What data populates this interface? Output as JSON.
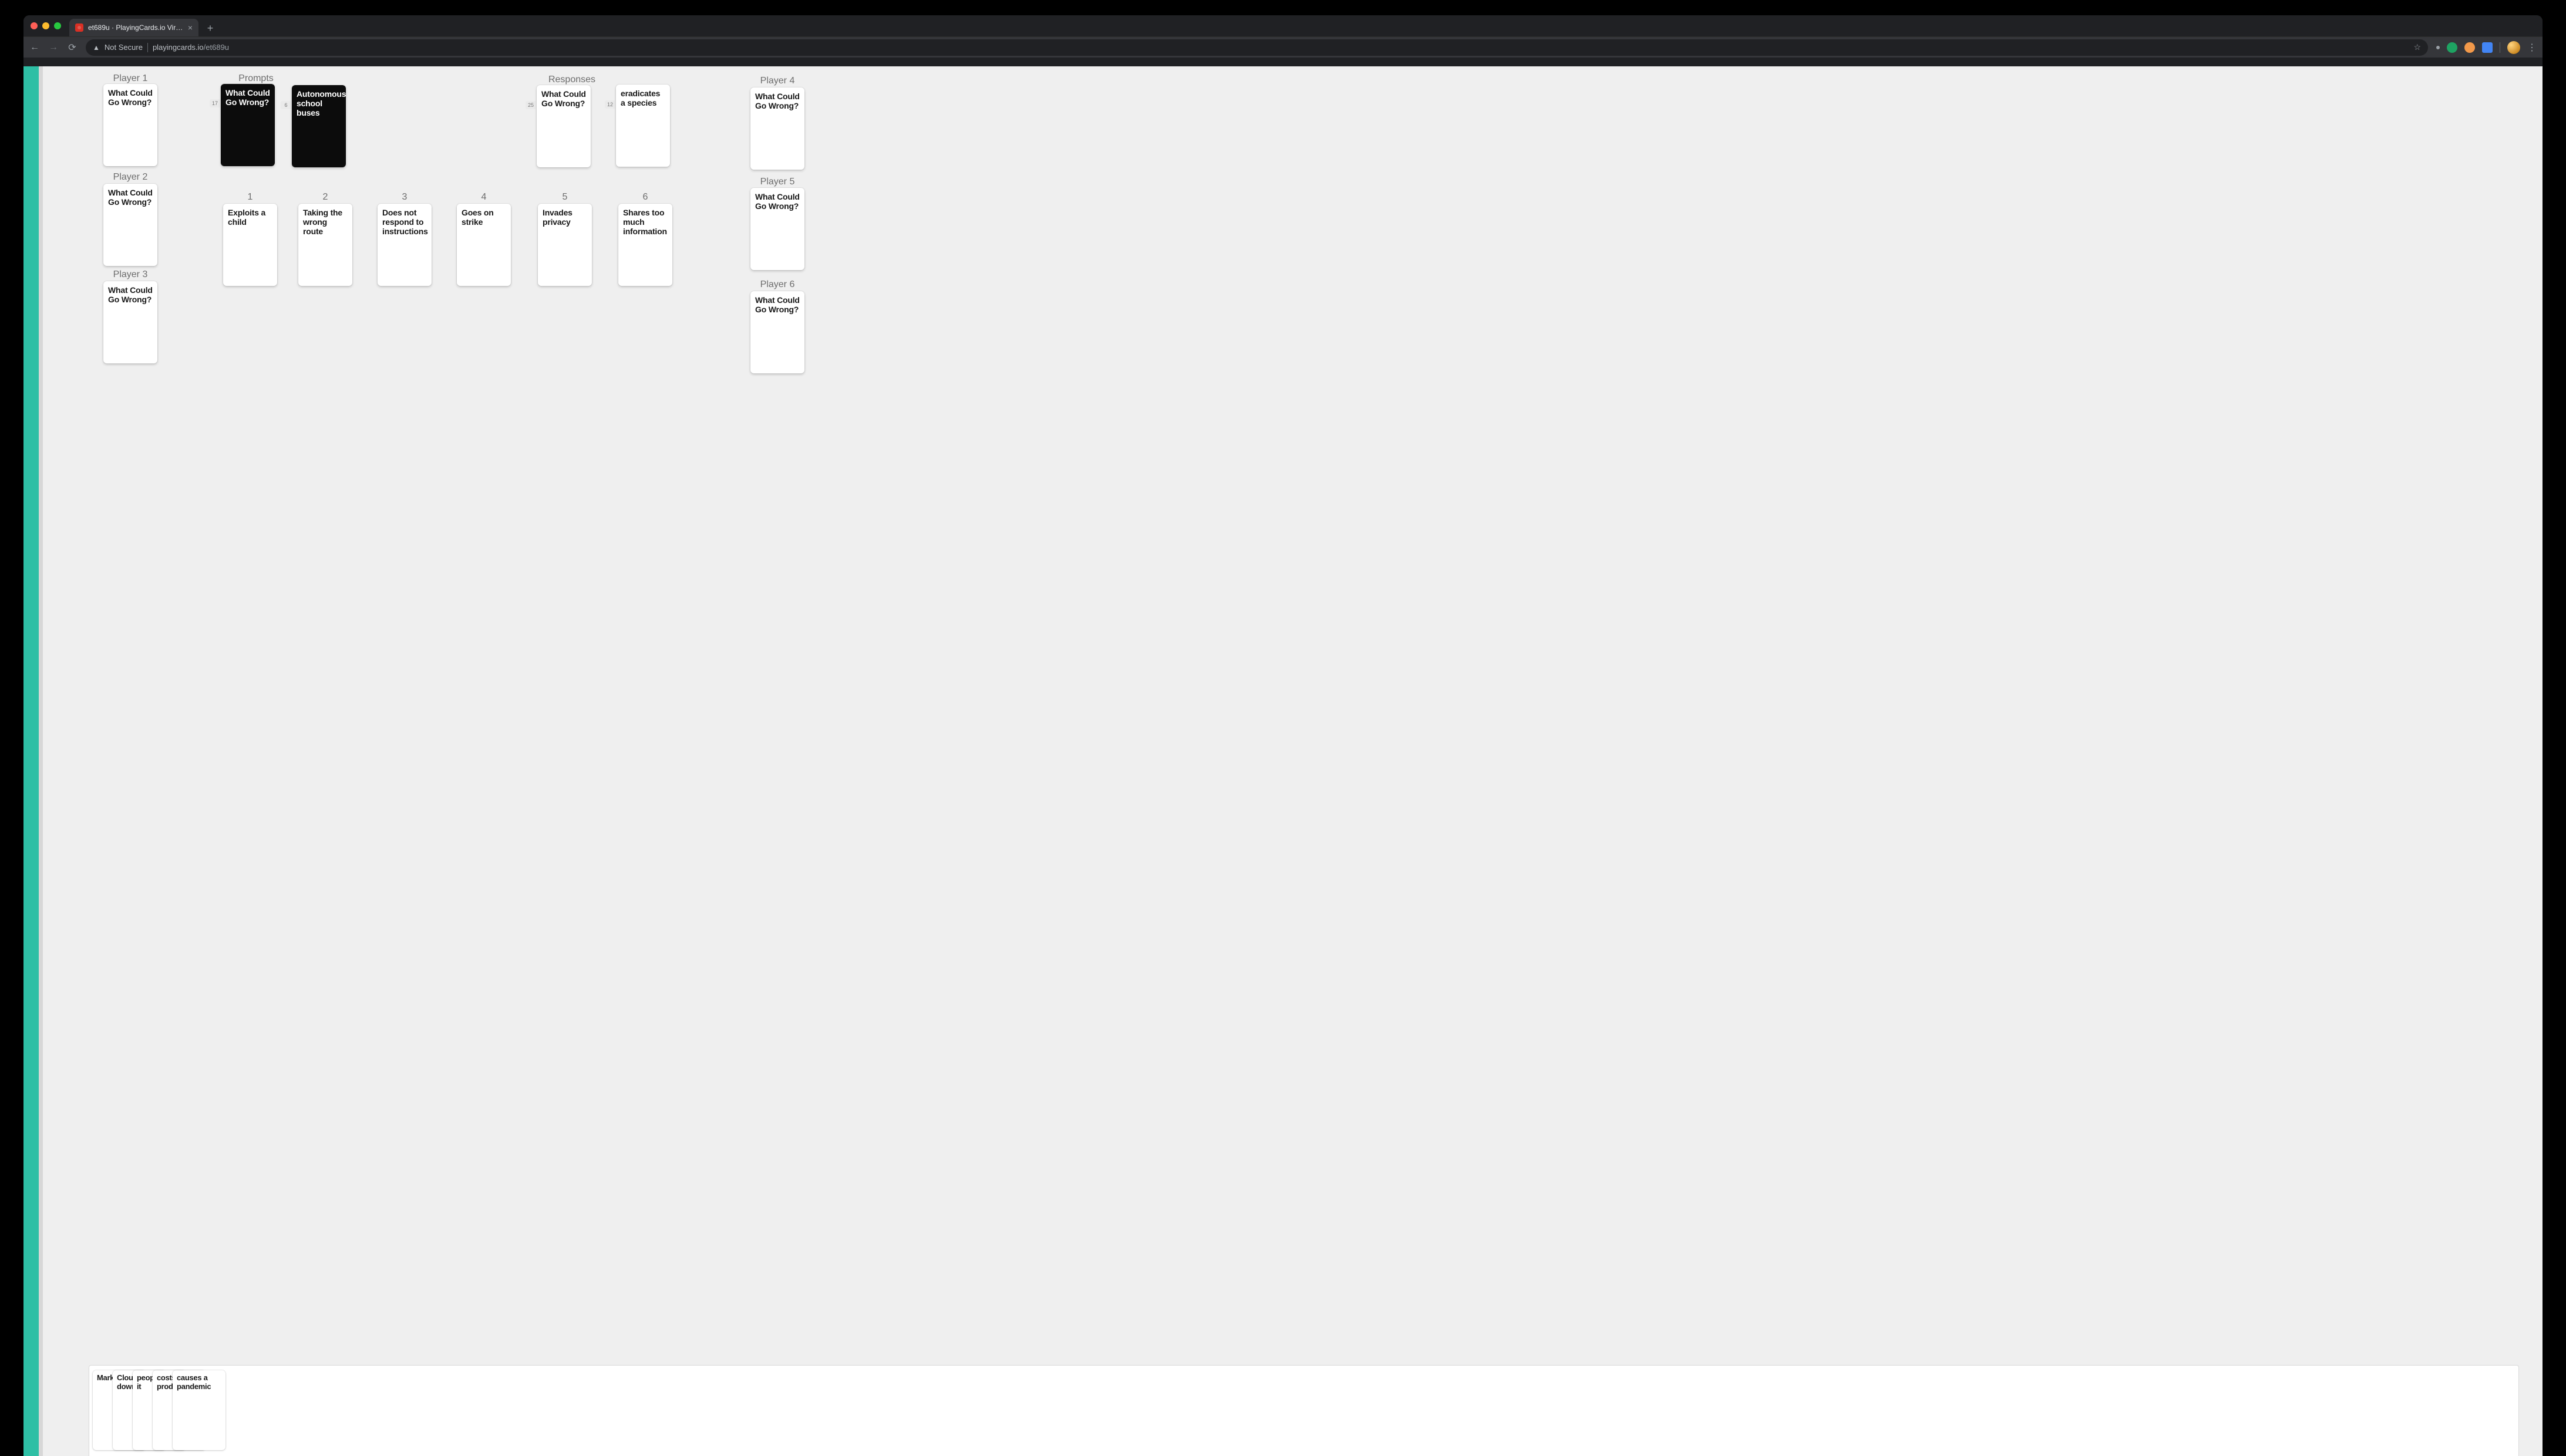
{
  "browser": {
    "tab_title": "et689u · PlayingCards.io Virtu…",
    "security_label": "Not Secure",
    "url_host": "playingcards.io",
    "url_path": "/et689u"
  },
  "players_left": [
    {
      "label": "Player 1",
      "card_text": "What Could Go Wrong?"
    },
    {
      "label": "Player 2",
      "card_text": "What Could Go Wrong?"
    },
    {
      "label": "Player 3",
      "card_text": "What Could Go Wrong?"
    }
  ],
  "players_right": [
    {
      "label": "Player 4",
      "card_text": "What Could Go Wrong?"
    },
    {
      "label": "Player 5",
      "card_text": "What Could Go Wrong?"
    },
    {
      "label": "Player 6",
      "card_text": "What Could Go Wrong?"
    }
  ],
  "prompts": {
    "label": "Prompts",
    "deck": {
      "count": "17",
      "top_text": "What Could Go Wrong?"
    },
    "drawn": {
      "count": "6",
      "text": "Autonomous school buses"
    }
  },
  "responses": {
    "label": "Responses",
    "deck": {
      "count": "25",
      "top_text": "What Could Go Wrong?"
    },
    "drawn": {
      "count": "12",
      "text": "eradicates a species"
    }
  },
  "play_slots": [
    {
      "num": "1",
      "text": "Exploits a child"
    },
    {
      "num": "2",
      "text": "Taking the wrong route"
    },
    {
      "num": "3",
      "text": "Does not respond to instructions"
    },
    {
      "num": "4",
      "text": "Goes on strike"
    },
    {
      "num": "5",
      "text": "Invades privacy"
    },
    {
      "num": "6",
      "text": "Shares too much information"
    }
  ],
  "hand": [
    {
      "text": "Mark melt"
    },
    {
      "text": "Clou servi down"
    },
    {
      "text": "peop addic it"
    },
    {
      "text": "costs mucl prod"
    },
    {
      "text": "causes a pandemic"
    }
  ]
}
